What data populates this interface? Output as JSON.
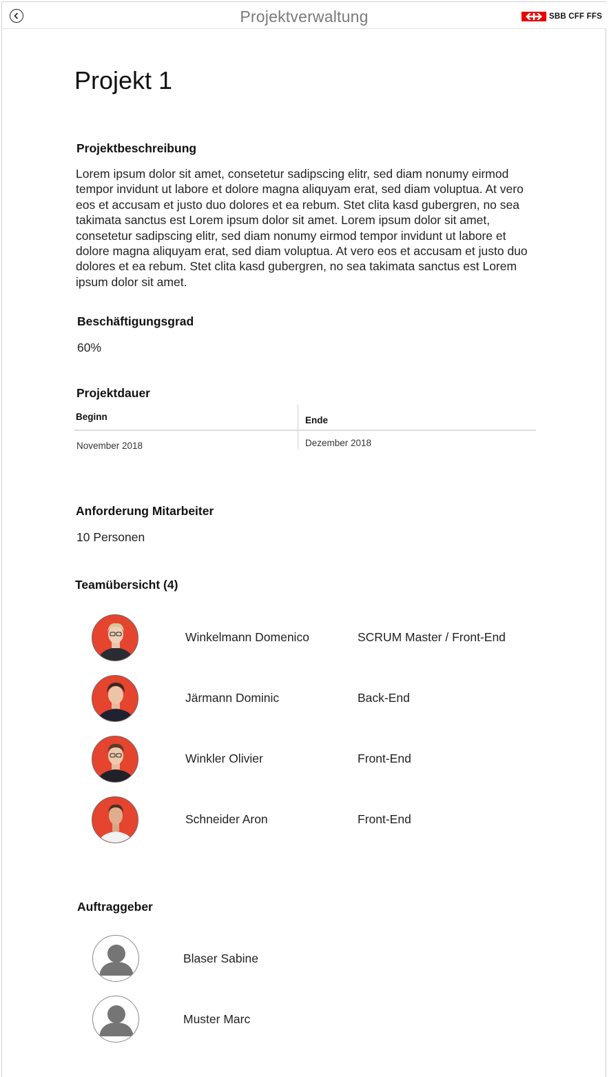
{
  "header": {
    "title": "Projektverwaltung",
    "back_icon": "chevron-left-circle-icon",
    "logo_text": "SBB CFF FFS",
    "logo_color": "#eb0000"
  },
  "project": {
    "title": "Projekt 1",
    "description_heading": "Projektbeschreibung",
    "description": "Lorem ipsum dolor sit amet, consetetur sadipscing elitr, sed diam nonumy eirmod tempor invidunt ut labore et dolore magna aliquyam erat, sed diam voluptua. At vero eos et accusam et justo duo dolores et ea rebum. Stet clita kasd gubergren, no sea takimata sanctus est Lorem ipsum dolor sit amet. Lorem ipsum dolor sit amet, consetetur sadipscing elitr, sed diam nonumy eirmod tempor invidunt ut labore et dolore magna aliquyam erat, sed diam voluptua. At vero eos et accusam et justo duo dolores et ea rebum. Stet clita kasd gubergren, no sea takimata sanctus est Lorem ipsum dolor sit amet.",
    "employment_heading": "Beschäftigungsgrad",
    "employment_value": "60%",
    "duration_heading": "Projektdauer",
    "duration": {
      "start_label": "Beginn",
      "end_label": "Ende",
      "start_value": "November 2018",
      "end_value": "Dezember 2018"
    },
    "staff_heading": "Anforderung Mitarbeiter",
    "staff_value": "10 Personen",
    "team_heading": "Teamübersicht (4)",
    "team": [
      {
        "name": "Winkelmann Domenico",
        "role": "SCRUM Master / Front-End",
        "avatar": "person-photo"
      },
      {
        "name": "Järmann Dominic",
        "role": "Back-End",
        "avatar": "person-photo"
      },
      {
        "name": "Winkler Olivier",
        "role": "Front-End",
        "avatar": "person-photo"
      },
      {
        "name": "Schneider Aron",
        "role": "Front-End",
        "avatar": "person-photo"
      }
    ],
    "clients_heading": "Auftraggeber",
    "clients": [
      {
        "name": "Blaser Sabine",
        "avatar": "user-placeholder-icon"
      },
      {
        "name": "Muster Marc",
        "avatar": "user-placeholder-icon"
      }
    ]
  },
  "colors": {
    "avatar_background": "#e5442f",
    "title_gray": "#7a7a7a"
  }
}
